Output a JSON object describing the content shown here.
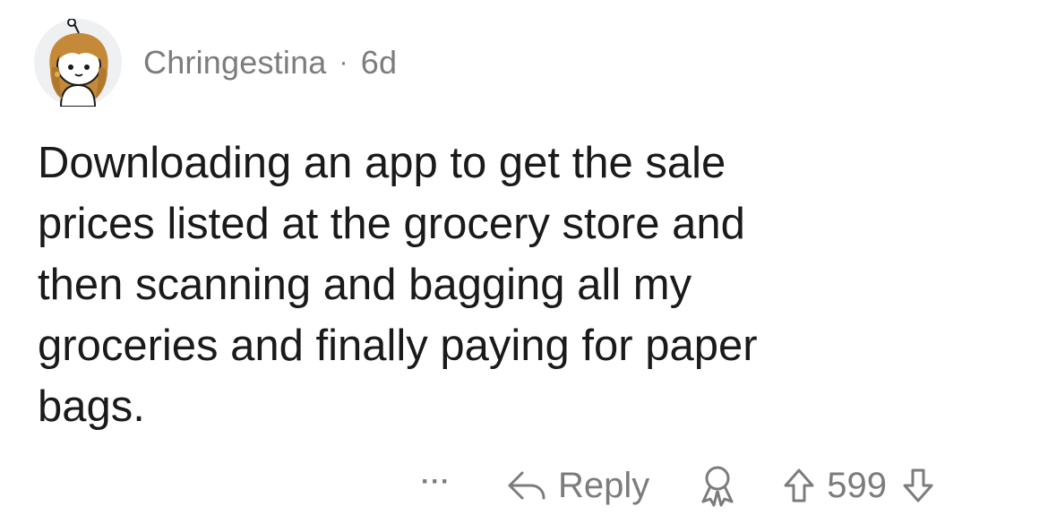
{
  "comment": {
    "author": "Chringestina",
    "separator": "·",
    "age": "6d",
    "text": "Downloading an app to get the sale\nprices listed at the grocery store and\nthen scanning and bagging all my\ngroceries and finally paying for paper\nbags.",
    "actions": {
      "more": "···",
      "reply_label": "Reply",
      "score": "599"
    },
    "icons": {
      "avatar": "snoo-avatar-icon",
      "more": "more-options-icon",
      "reply": "reply-arrow-icon",
      "award": "award-icon",
      "upvote": "upvote-arrow-icon",
      "downvote": "downvote-arrow-icon"
    },
    "colors": {
      "text": "#1a1a1b",
      "meta": "#7c7c7c",
      "background": "#ffffff"
    }
  }
}
